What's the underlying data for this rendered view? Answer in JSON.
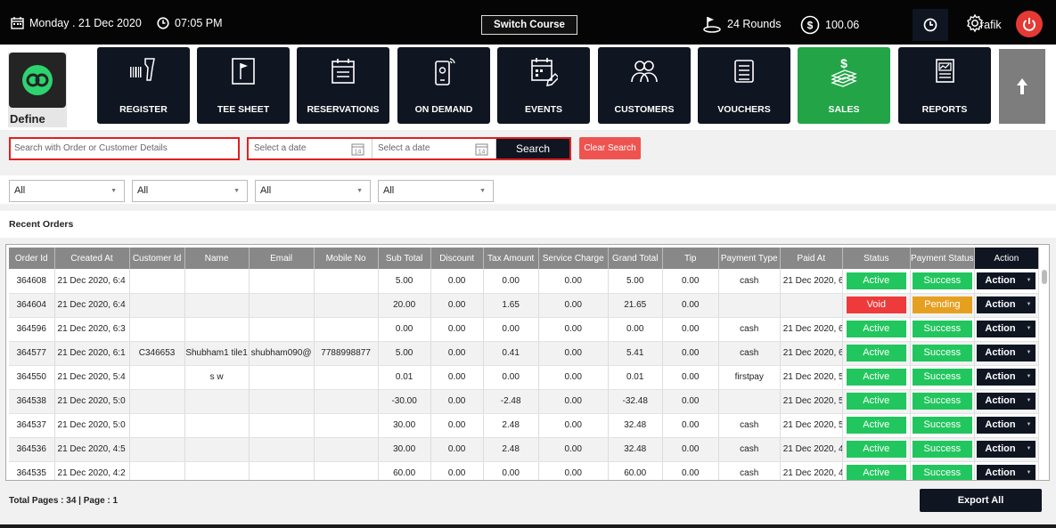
{
  "header": {
    "date": "Monday . 21 Dec 2020",
    "time": "07:05 PM",
    "switch_course": "Switch Course",
    "rounds": "24 Rounds",
    "balance": "100.06",
    "username": "rafik"
  },
  "logo": {
    "label": "Define"
  },
  "nav": [
    {
      "label": "REGISTER",
      "icon": "barcode-scanner-icon"
    },
    {
      "label": "TEE SHEET",
      "icon": "tee-sheet-flag-icon"
    },
    {
      "label": "RESERVATIONS",
      "icon": "calendar-icon"
    },
    {
      "label": "ON DEMAND",
      "icon": "mobile-signal-icon"
    },
    {
      "label": "EVENTS",
      "icon": "calendar-edit-icon"
    },
    {
      "label": "CUSTOMERS",
      "icon": "users-icon"
    },
    {
      "label": "VOUCHERS",
      "icon": "list-icon"
    },
    {
      "label": "SALES",
      "icon": "money-icon",
      "active": true
    },
    {
      "label": "REPORTS",
      "icon": "report-icon"
    }
  ],
  "search": {
    "placeholder": "Search with Order or Customer Details",
    "date_from": "Select a date",
    "date_to": "Select a date",
    "search_label": "Search",
    "clear_label": "Clear Search"
  },
  "filters": [
    "All",
    "All",
    "All",
    "All"
  ],
  "section_title": "Recent Orders",
  "table": {
    "headers": [
      "Order Id",
      "Created At",
      "Customer Id",
      "Name",
      "Email",
      "Mobile No",
      "Sub Total",
      "Discount",
      "Tax Amount",
      "Service Charge",
      "Grand Total",
      "Tip",
      "Payment Type",
      "Paid At",
      "Status",
      "Payment Status",
      "Action"
    ],
    "rows": [
      [
        "364608",
        "21 Dec 2020, 6:4",
        "",
        "",
        "",
        "",
        "5.00",
        "0.00",
        "0.00",
        "0.00",
        "5.00",
        "0.00",
        "cash",
        "21 Dec 2020, 6:4",
        "Active",
        "Success",
        "Action"
      ],
      [
        "364604",
        "21 Dec 2020, 6:4",
        "",
        "",
        "",
        "",
        "20.00",
        "0.00",
        "1.65",
        "0.00",
        "21.65",
        "0.00",
        "",
        "",
        "Void",
        "Pending",
        "Action"
      ],
      [
        "364596",
        "21 Dec 2020, 6:3",
        "",
        "",
        "",
        "",
        "0.00",
        "0.00",
        "0.00",
        "0.00",
        "0.00",
        "0.00",
        "cash",
        "21 Dec 2020, 6:3",
        "Active",
        "Success",
        "Action"
      ],
      [
        "364577",
        "21 Dec 2020, 6:1",
        "C346653",
        "Shubham1 tile1",
        "shubham090@",
        "7788998877",
        "5.00",
        "0.00",
        "0.41",
        "0.00",
        "5.41",
        "0.00",
        "cash",
        "21 Dec 2020, 6:1",
        "Active",
        "Success",
        "Action"
      ],
      [
        "364550",
        "21 Dec 2020, 5:4",
        "",
        "s w",
        "",
        "",
        "0.01",
        "0.00",
        "0.00",
        "0.00",
        "0.01",
        "0.00",
        "firstpay",
        "21 Dec 2020, 5:4",
        "Active",
        "Success",
        "Action"
      ],
      [
        "364538",
        "21 Dec 2020, 5:0",
        "",
        "",
        "",
        "",
        "-30.00",
        "0.00",
        "-2.48",
        "0.00",
        "-32.48",
        "0.00",
        "",
        "21 Dec 2020, 5:0",
        "Active",
        "Success",
        "Action"
      ],
      [
        "364537",
        "21 Dec 2020, 5:0",
        "",
        "",
        "",
        "",
        "30.00",
        "0.00",
        "2.48",
        "0.00",
        "32.48",
        "0.00",
        "cash",
        "21 Dec 2020, 5:0",
        "Active",
        "Success",
        "Action"
      ],
      [
        "364536",
        "21 Dec 2020, 4:5",
        "",
        "",
        "",
        "",
        "30.00",
        "0.00",
        "2.48",
        "0.00",
        "32.48",
        "0.00",
        "cash",
        "21 Dec 2020, 4:5",
        "Active",
        "Success",
        "Action"
      ],
      [
        "364535",
        "21 Dec 2020, 4:2",
        "",
        "",
        "",
        "",
        "60.00",
        "0.00",
        "0.00",
        "0.00",
        "60.00",
        "0.00",
        "cash",
        "21 Dec 2020, 4:2",
        "Active",
        "Success",
        "Action"
      ]
    ]
  },
  "footer": {
    "page_info": "Total Pages : 34 | Page : 1",
    "export_label": "Export All"
  },
  "colors": {
    "dark_tile": "#101522",
    "active_tile": "#22a447",
    "active_status": "#22c65e",
    "void_status": "#ee3a3a",
    "pending_status": "#e6a020",
    "alert_red": "#e02020"
  }
}
